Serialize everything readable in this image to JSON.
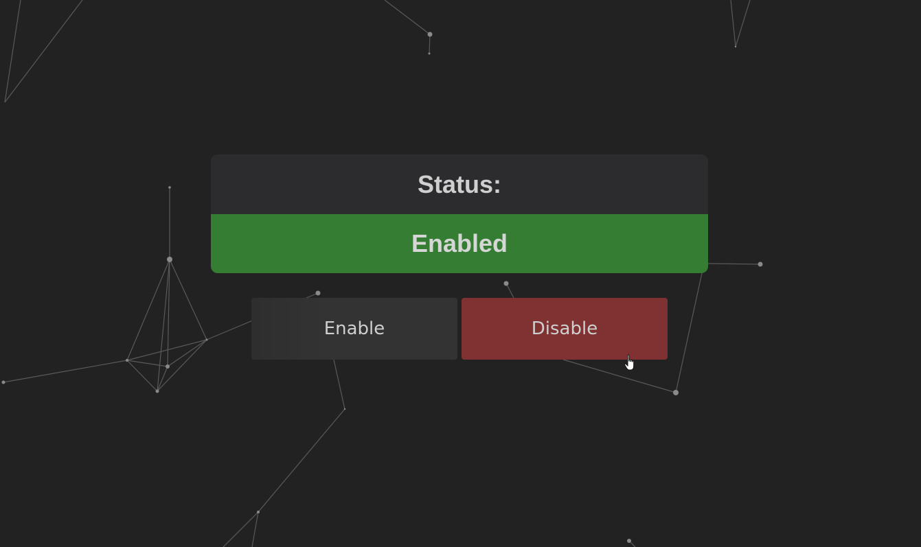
{
  "status": {
    "heading": "Status:",
    "value": "Enabled",
    "value_color": "#347d33"
  },
  "buttons": {
    "enable_label": "Enable",
    "disable_label": "Disable",
    "disable_color": "#803233"
  },
  "background": {
    "color": "#222222",
    "decoration": "particle-network"
  }
}
